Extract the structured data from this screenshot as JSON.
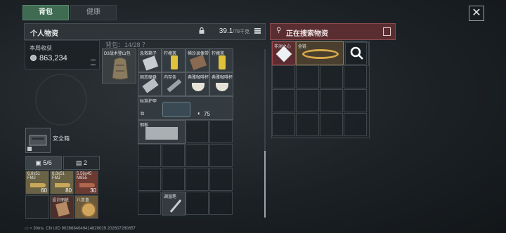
{
  "tabs": [
    {
      "label": "背包",
      "active": true
    },
    {
      "label": "健康",
      "active": false
    }
  ],
  "inventory": {
    "title": "个人物资",
    "weight_value": "39.1",
    "weight_capacity": "/78千克",
    "income_label": "本局收获",
    "income_value": "863,234",
    "safebox_label": "安全箱",
    "stat_a": "5/6",
    "stat_b": "2",
    "backpack_label": "背包：14/28 ？"
  },
  "equipment_slots": [
    {
      "label": "D3战术登山包",
      "icon": "backpack-icon"
    }
  ],
  "backpack_items": [
    {
      "label": "急救箱子",
      "icon": "medkit-icon"
    },
    {
      "label": "柠檬茶",
      "icon": "can-icon"
    },
    {
      "label": "稀珍录像带",
      "icon": "tape-icon"
    },
    {
      "label": "柠檬茶",
      "icon": "can-icon"
    },
    {
      "label": "固态硬盘",
      "icon": "ssd-icon"
    },
    {
      "label": "内存条",
      "icon": "ram-icon"
    },
    {
      "label": "典雅咖啡杯",
      "icon": "coffee-cup-icon"
    },
    {
      "label": "典雅咖啡杯",
      "icon": "coffee-cup-icon"
    },
    {
      "label": "标准护甲",
      "icon": "armor-icon",
      "durability": "75"
    },
    {
      "label": "钢板",
      "icon": "steel-plate-icon"
    },
    {
      "label": "调温笔",
      "icon": "pen-icon"
    }
  ],
  "ammo_items": [
    {
      "label": "6.8x51\nFMJ",
      "count": "60"
    },
    {
      "label": "6.8x51\nFMJ",
      "count": "80"
    },
    {
      "label": "5.56x45\nM855",
      "count": "30"
    },
    {
      "label": "设计图纸",
      "count": ""
    },
    {
      "label": "八音盒",
      "count": ""
    }
  ],
  "search_panel": {
    "title": "正在搜索物资",
    "items": [
      {
        "label": "非洲之心",
        "icon": "diamond-icon"
      },
      {
        "label": "金链",
        "icon": "gold-chain-icon"
      }
    ]
  },
  "status_bar": {
    "ping": "30ms",
    "uid": "CN UID 9026684049414820029 202607280857"
  },
  "colors": {
    "active_tab": "#3f6b52",
    "search_header": "#5a2e31",
    "grid_line": "#40474c"
  }
}
